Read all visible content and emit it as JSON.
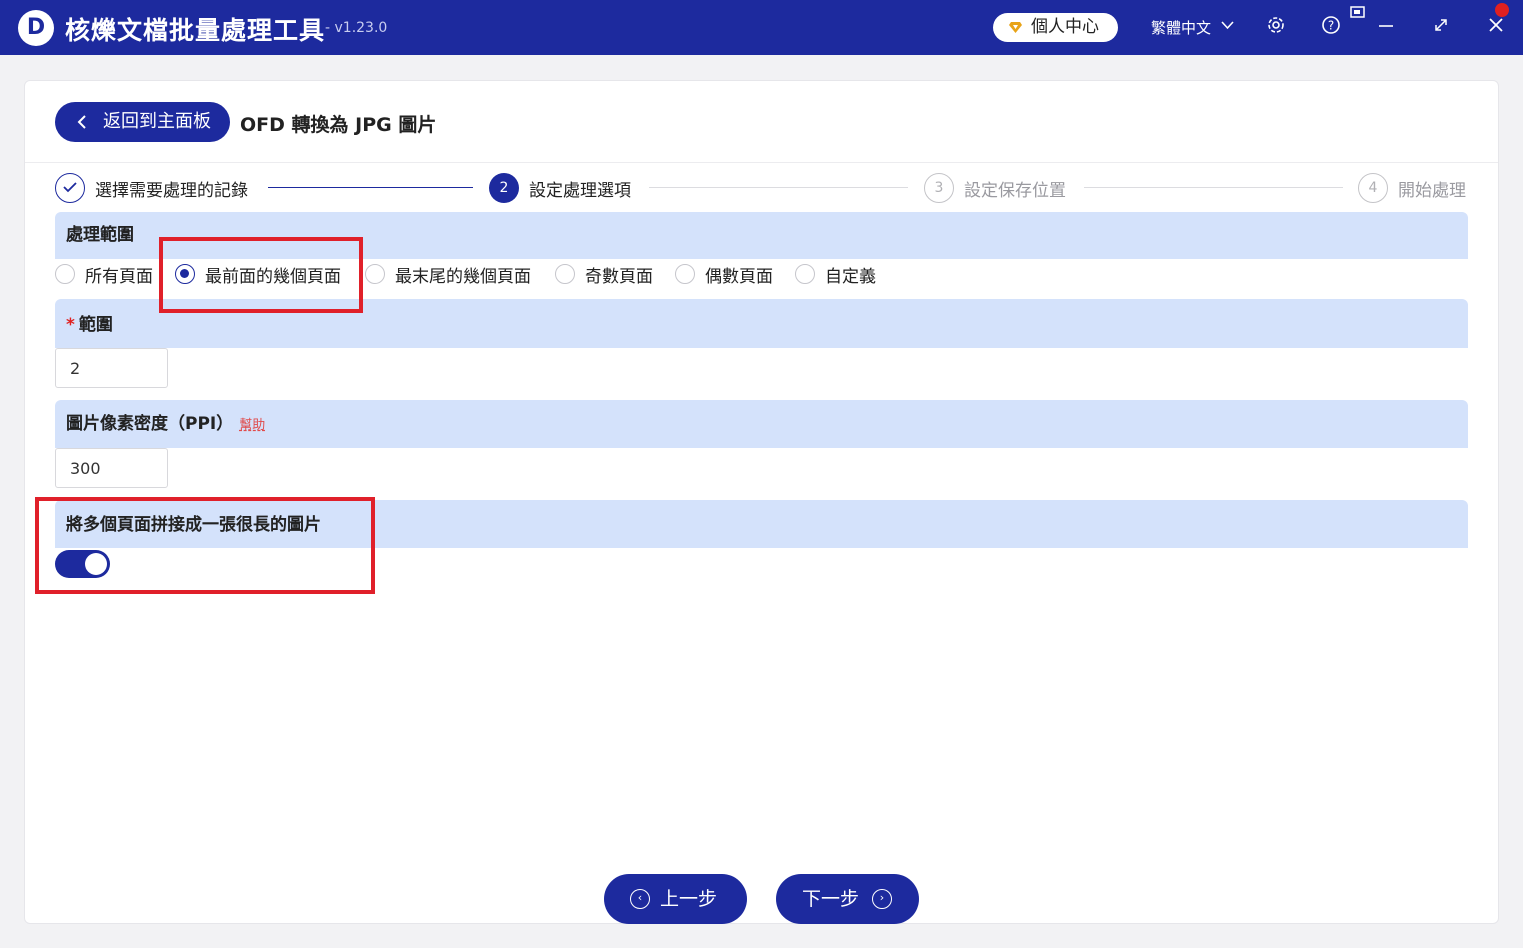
{
  "app": {
    "logo_letter": "D",
    "title": "核爍文檔批量處理工具",
    "version": "- v1.23.0",
    "user_center": "個人中心",
    "language": "繁體中文",
    "icons": [
      "settings-icon",
      "help-icon",
      "restore-icon",
      "minimize-icon",
      "maximize-icon",
      "close-icon"
    ]
  },
  "header": {
    "back_label": "返回到主面板",
    "page_title": "OFD 轉換為 JPG 圖片"
  },
  "steps": [
    {
      "number": "✓",
      "label": "選擇需要處理的記錄",
      "state": "done"
    },
    {
      "number": "2",
      "label": "設定處理選項",
      "state": "active"
    },
    {
      "number": "3",
      "label": "設定保存位置",
      "state": "todo"
    },
    {
      "number": "4",
      "label": "開始處理",
      "state": "todo"
    }
  ],
  "range_section": {
    "title": "處理範圍",
    "options": [
      "所有頁面",
      "最前面的幾個頁面",
      "最末尾的幾個頁面",
      "奇數頁面",
      "偶數頁面",
      "自定義"
    ],
    "selected": "最前面的幾個頁面"
  },
  "range_field": {
    "required_mark": "*",
    "title": "範圍",
    "value": "2"
  },
  "ppi_field": {
    "title": "圖片像素密度（PPI）",
    "help": "幫助",
    "value": "300"
  },
  "merge_section": {
    "title": "將多個頁面拼接成一張很長的圖片",
    "enabled": true
  },
  "footer": {
    "prev_label": "上一步",
    "next_label": "下一步"
  },
  "colors": {
    "primary": "#1d2a9e",
    "section_bg": "#d4e2fb",
    "highlight": "#e0202a"
  }
}
